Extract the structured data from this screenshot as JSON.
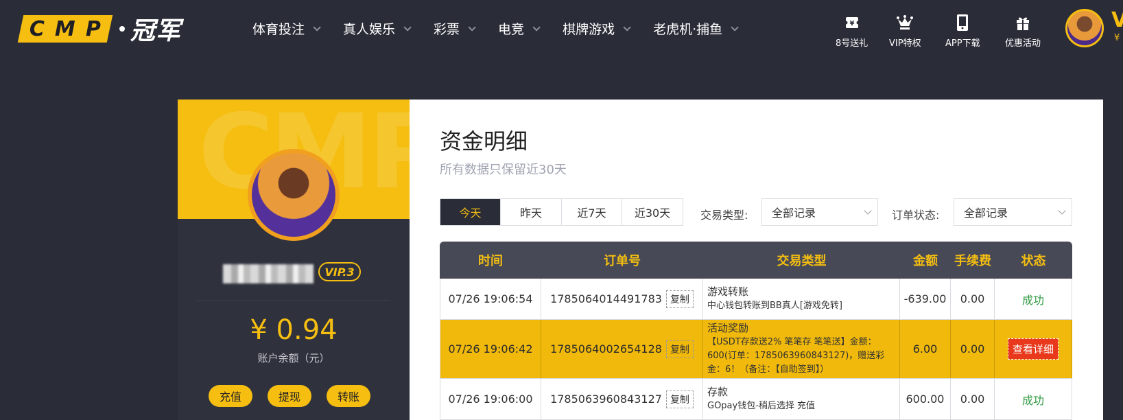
{
  "logo": {
    "letters": [
      "C",
      "M",
      "P"
    ],
    "cn": "冠军"
  },
  "nav": [
    {
      "label": "体育投注"
    },
    {
      "label": "真人娱乐"
    },
    {
      "label": "彩票"
    },
    {
      "label": "电竞"
    },
    {
      "label": "棋牌游戏"
    },
    {
      "label": "老虎机·捕鱼"
    }
  ],
  "quick_links": [
    {
      "label": "8号送礼",
      "icon": "ticket-icon"
    },
    {
      "label": "VIP特权",
      "icon": "crown-icon"
    },
    {
      "label": "APP下载",
      "icon": "phone-icon"
    },
    {
      "label": "优惠活动",
      "icon": "gift-icon"
    }
  ],
  "user_top": {
    "initial": "V",
    "currency": "¥"
  },
  "profile": {
    "watermark": "CMP",
    "vip": "VIP.3",
    "balance": "¥ 0.94",
    "balance_label": "账户余额（元）",
    "buttons": [
      "充值",
      "提现",
      "转账"
    ]
  },
  "panel": {
    "title": "资金明细",
    "subtitle": "所有数据只保留近30天",
    "ranges": [
      "今天",
      "昨天",
      "近7天",
      "近30天"
    ],
    "active_range": "今天",
    "filter_type_label": "交易类型:",
    "filter_type_value": "全部记录",
    "filter_status_label": "订单状态:",
    "filter_status_value": "全部记录"
  },
  "table": {
    "headers": [
      "时间",
      "订单号",
      "交易类型",
      "金额",
      "手续费",
      "状态"
    ],
    "copy_label": "复制",
    "rows": [
      {
        "time": "07/26 19:06:54",
        "order": "1785064014491783",
        "type": "游戏转账",
        "type_detail": "中心钱包转账到BB真人[游戏免转]",
        "amount": "-639.00",
        "fee": "0.00",
        "status": "成功",
        "highlight": false
      },
      {
        "time": "07/26 19:06:42",
        "order": "1785064002654128",
        "type": "活动奖励",
        "type_detail": "【USDT存款送2% 笔笔存 笔笔送】金额：600(订单：1785063960843127)，赠送彩金：6！（备注：【自助签到】）",
        "amount": "6.00",
        "fee": "0.00",
        "status": "查看详细",
        "highlight": true
      },
      {
        "time": "07/26 19:06:00",
        "order": "1785063960843127",
        "type": "存款",
        "type_detail": "GOpay钱包-稍后选择 充值",
        "amount": "600.00",
        "fee": "0.00",
        "status": "成功",
        "highlight": false
      }
    ]
  },
  "colors": {
    "accent": "#f5be11",
    "bg": "#2a2c37",
    "success": "#2f9a41",
    "danger": "#e8391c"
  }
}
